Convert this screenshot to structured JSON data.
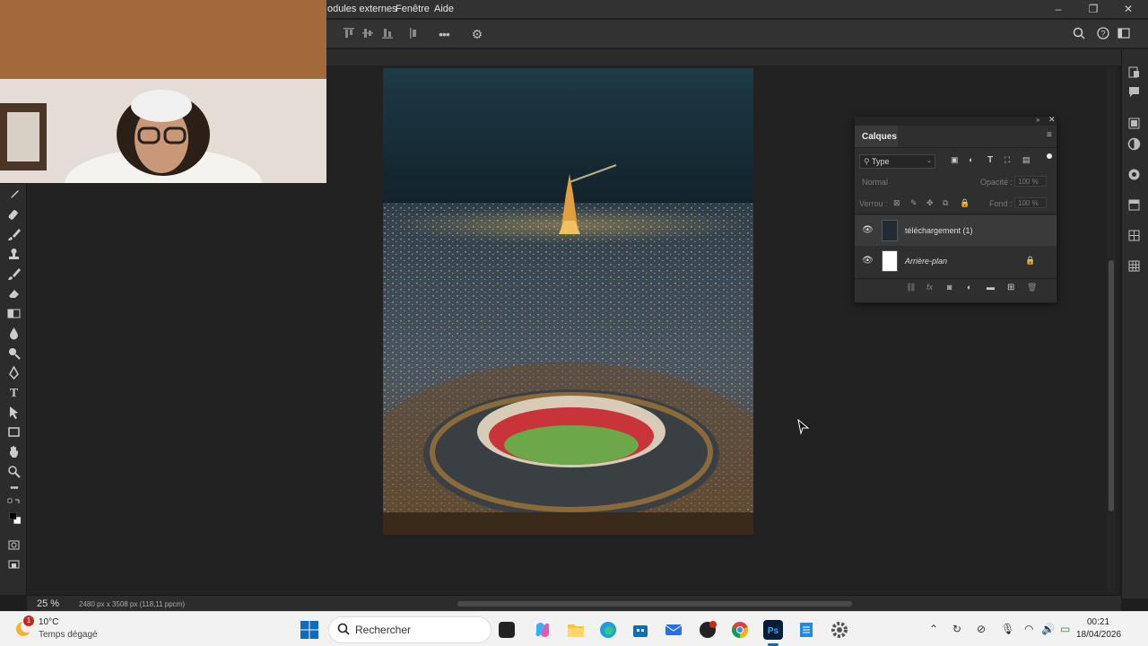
{
  "menu": {
    "items": [
      "odules externes",
      "Fenêtre",
      "Aide"
    ]
  },
  "window_controls": {
    "minimize": "–",
    "restore": "❐",
    "close": "✕"
  },
  "status": {
    "zoom": "25 %",
    "doc_info": "2480 px x 3508 px (118,11 ppcm)"
  },
  "layers_panel": {
    "tab": "Calques",
    "filter": "Type",
    "blend_mode": "Normal",
    "opacity_label": "Opacité :",
    "opacity_value": "100 %",
    "lock_label": "Verrou :",
    "fill_label": "Fond :",
    "fill_value": "100 %",
    "layers": [
      {
        "name": "téléchargement (1)",
        "visible": true,
        "locked": false
      },
      {
        "name": "Arrière-plan",
        "visible": true,
        "locked": true
      }
    ]
  },
  "taskbar": {
    "weather_temp": "10°C",
    "weather_desc": "Temps dégagé",
    "weather_badge": "1",
    "search_placeholder": "Rechercher",
    "time": "00:21",
    "date": "18/04/2026"
  },
  "colors": {
    "ps_bg": "#1e1e1e",
    "panel": "#2f2f2f",
    "taskbar": "#f2f2f2",
    "accent": "#31a8ff"
  }
}
